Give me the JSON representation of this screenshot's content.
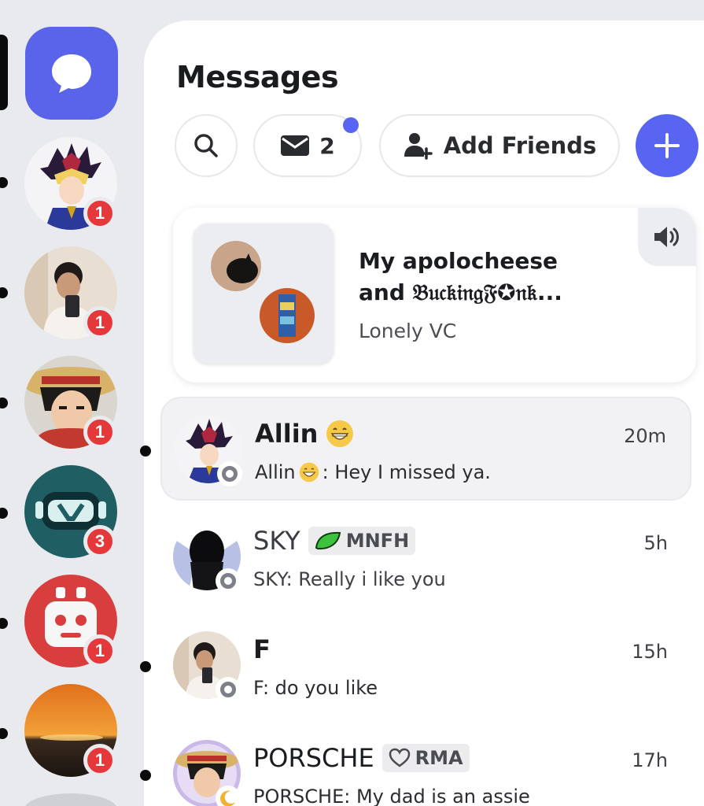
{
  "rail": {
    "servers": [
      {
        "name": "yugi",
        "badge": "1"
      },
      {
        "name": "mirror-selfie",
        "badge": "1"
      },
      {
        "name": "luffy",
        "badge": "1"
      },
      {
        "name": "goggles-bot",
        "badge": "3"
      },
      {
        "name": "robot-app",
        "badge": "1"
      },
      {
        "name": "sunset",
        "badge": "1"
      }
    ]
  },
  "header": {
    "title": "Messages",
    "inbox_count": "2",
    "add_friends_label": "Add Friends"
  },
  "voice_chat": {
    "title_line1": "My apolocheese",
    "title_line2": "and 𝔅𝔲𝔠𝔨𝔦𝔫𝔤𝔉✪𝔫𝔨...",
    "subtitle": "Lonely VC"
  },
  "conversations": [
    {
      "name": "Allin",
      "preview_author": "Allin",
      "preview_text": ": Hey I missed ya.",
      "time": "20m",
      "active": true
    },
    {
      "name": "SKY",
      "tag": "MNFH",
      "preview": "SKY: Really i like you",
      "time": "5h"
    },
    {
      "name": "F",
      "preview": "F: do you like",
      "time": "15h"
    },
    {
      "name": "PORSCHE",
      "tag": "RMA",
      "preview": "PORSCHE: My dad is an assie",
      "time": "17h"
    }
  ],
  "colors": {
    "accent": "#5865f2",
    "badge": "#e5383b",
    "rail_bg": "#e9eaed"
  }
}
